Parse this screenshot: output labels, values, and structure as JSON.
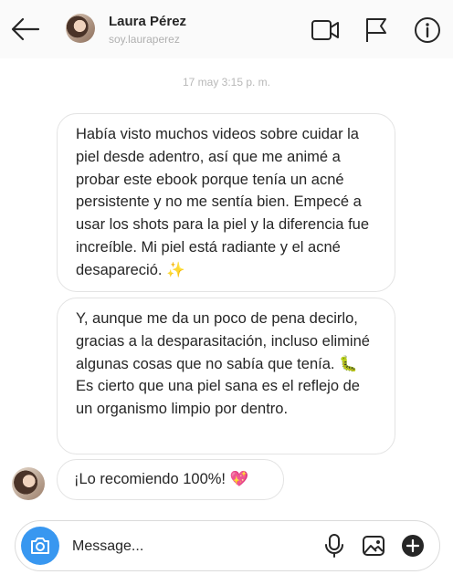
{
  "header": {
    "name": "Laura Pérez",
    "username": "soy.lauraperez",
    "icons": [
      "back-arrow-icon",
      "video-camera-icon",
      "flag-icon",
      "info-icon"
    ]
  },
  "thread": {
    "timestamp": "17 may 3:15 p. m.",
    "messages": [
      {
        "text": "Había visto muchos videos sobre cuidar la piel desde adentro, así que me animé a probar este ebook porque tenía un acné persistente y no me sentía bien. Empecé a usar los shots para la piel y la diferencia fue increíble. Mi piel está radiante y el acné desapareció. ✨"
      },
      {
        "text": "Y, aunque me da un poco de pena decirlo, gracias a la desparasitación, incluso eliminé algunas cosas que no sabía que tenía. 🐛 Es cierto que una piel sana es el reflejo de un organismo limpio por dentro."
      },
      {
        "text": "¡Lo recomiendo 100%! 💖"
      }
    ]
  },
  "composer": {
    "placeholder": "Message...",
    "icons": [
      "camera-icon",
      "microphone-icon",
      "gallery-icon",
      "plus-icon"
    ],
    "accent_color": "#3897f0"
  }
}
